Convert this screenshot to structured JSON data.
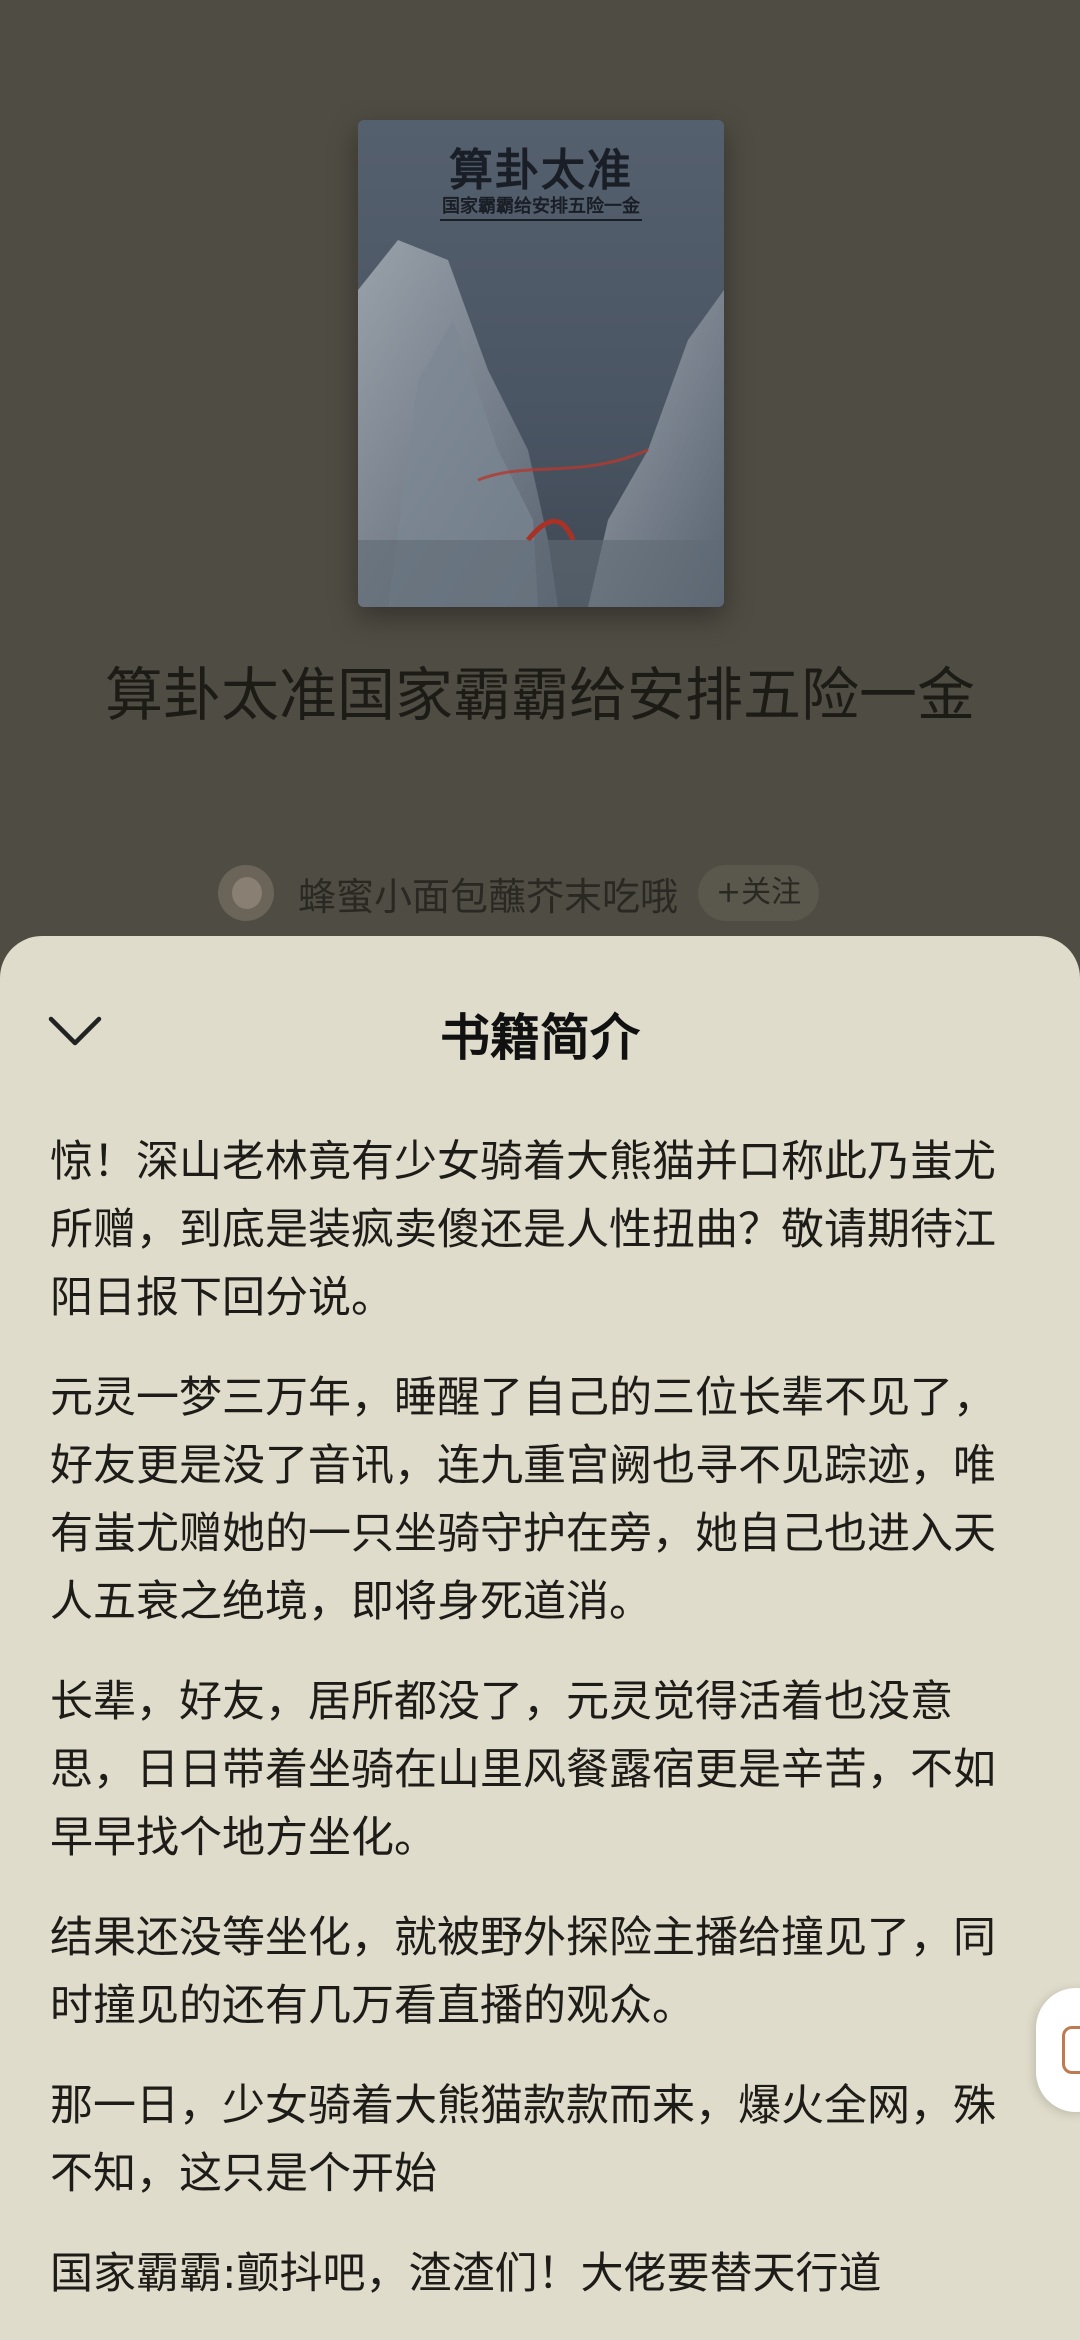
{
  "book": {
    "cover_title": "算卦太准",
    "cover_subtitle": "国家霸霸给安排五险一金",
    "title": "算卦太准国家霸霸给安排五险一金"
  },
  "author": {
    "name": "蜂蜜小面包蘸芥末吃哦",
    "follow_label": "+关注"
  },
  "sheet": {
    "title": "书籍简介",
    "paragraphs": [
      "惊！深山老林竟有少女骑着大熊猫并口称此乃蚩尤所赠，到底是装疯卖傻还是人性扭曲？敬请期待江阳日报下回分说。",
      "元灵一梦三万年，睡醒了自己的三位长辈不见了，好友更是没了音讯，连九重宫阙也寻不见踪迹，唯有蚩尤赠她的一只坐骑守护在旁，她自己也进入天人五衰之绝境，即将身死道消。",
      "长辈，好友，居所都没了，元灵觉得活着也没意思，日日带着坐骑在山里风餐露宿更是辛苦，不如早早找个地方坐化。",
      "结果还没等坐化，就被野外探险主播给撞见了，同时撞见的还有几万看直播的观众。",
      "那一日，少女骑着大熊猫款款而来，爆火全网，殊不知，这只是个开始",
      "国家霸霸:颤抖吧，渣渣们！大佬要替天行道"
    ]
  },
  "icons": {
    "collapse": "chevron-down-icon",
    "side_float": "floating-assistant-icon"
  },
  "colors": {
    "dim_background": "#4f4c43",
    "sheet_background": "#e0dccb",
    "text": "#1e1c18"
  }
}
